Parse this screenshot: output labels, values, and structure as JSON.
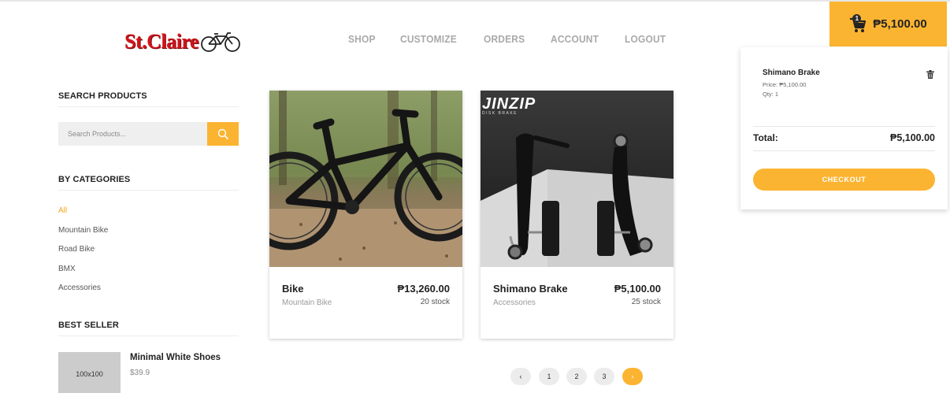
{
  "brand": {
    "name": "St.Claire"
  },
  "nav": {
    "items": [
      "SHOP",
      "CUSTOMIZE",
      "ORDERS",
      "ACCOUNT",
      "LOGOUT"
    ]
  },
  "cart": {
    "count": "1",
    "total": "₱5,100.00",
    "items": [
      {
        "name": "Shimano Brake",
        "price": "Price: ₱5,100.00",
        "qty": "Qty: 1"
      }
    ],
    "total_label": "Total:",
    "total_value": "₱5,100.00",
    "checkout_label": "CHECKOUT"
  },
  "sidebar": {
    "search_heading": "SEARCH PRODUCTS",
    "search_placeholder": "Search Products...",
    "categories_heading": "BY CATEGORIES",
    "categories": [
      "All",
      "Mountain Bike",
      "Road Bike",
      "BMX",
      "Accessories"
    ],
    "active_category": "All",
    "best_seller_heading": "BEST SELLER",
    "best_seller": {
      "thumb_label": "100x100",
      "name": "Minimal White Shoes",
      "price": "$39.9"
    }
  },
  "products": [
    {
      "name": "Bike",
      "category": "Mountain Bike",
      "price": "₱13,260.00",
      "stock": "20 stock"
    },
    {
      "name": "Shimano Brake",
      "category": "Accessories",
      "price": "₱5,100.00",
      "stock": "25 stock",
      "image_text": "JINZIP",
      "image_subtext": "DISK BRAKE"
    }
  ],
  "pagination": {
    "prev": "‹",
    "pages": [
      "1",
      "2",
      "3"
    ],
    "next": "›"
  },
  "colors": {
    "accent": "#fbb431",
    "brand_red": "#d0141b"
  }
}
